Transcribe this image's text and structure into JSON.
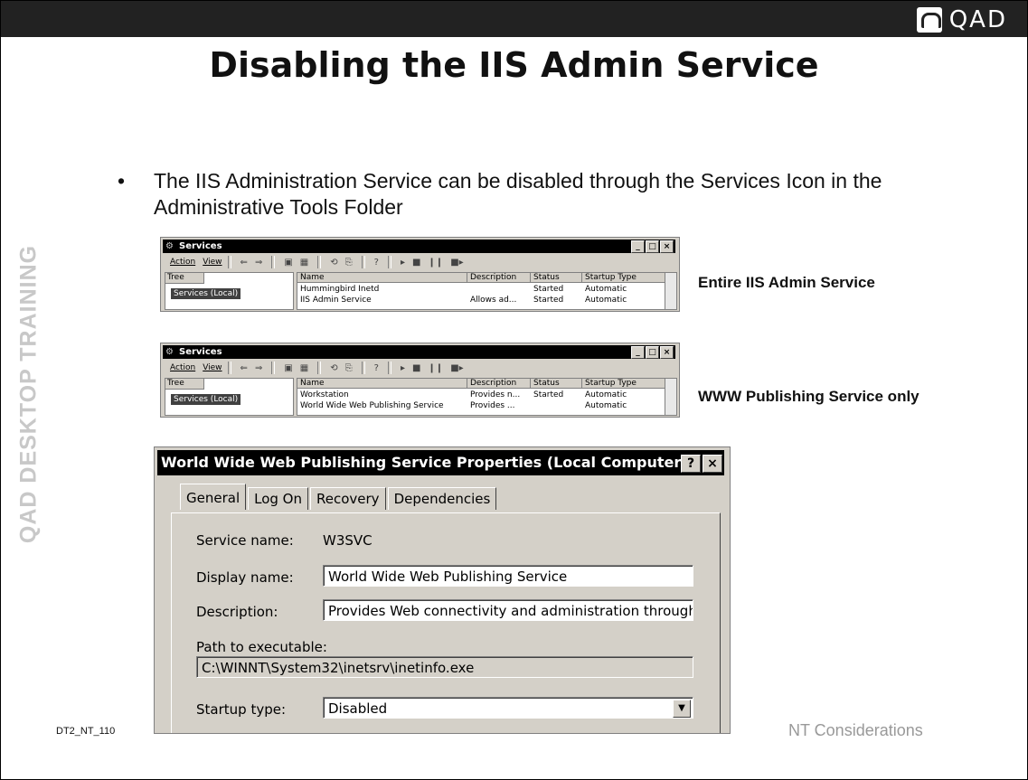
{
  "slide": {
    "logo": "QAD",
    "title": "Disabling the IIS Admin Service",
    "side_text": "QAD DESKTOP TRAINING",
    "bullet_char": "•",
    "bullet_text": "The IIS Administration Service can be disabled through the Services Icon in the Administrative Tools Folder",
    "footer_left": "DT2_NT_110",
    "footer_right": "NT Considerations"
  },
  "services_window_1": {
    "title": "Services",
    "caption": "Entire IIS Admin Service",
    "menu": [
      "Action",
      "View"
    ],
    "tree_header": "Tree",
    "tree_item": "Services (Local)",
    "columns": [
      "Name",
      "Description",
      "Status",
      "Startup Type"
    ],
    "rows": [
      [
        "Hummingbird Inetd",
        "",
        "Started",
        "Automatic"
      ],
      [
        "IIS Admin Service",
        "Allows ad...",
        "Started",
        "Automatic"
      ]
    ]
  },
  "services_window_2": {
    "title": "Services",
    "caption": "WWW Publishing Service only",
    "menu": [
      "Action",
      "View"
    ],
    "tree_header": "Tree",
    "tree_item": "Services (Local)",
    "columns": [
      "Name",
      "Description",
      "Status",
      "Startup Type"
    ],
    "rows": [
      [
        "Workstation",
        "Provides n...",
        "Started",
        "Automatic"
      ],
      [
        "World Wide Web Publishing Service",
        "Provides ...",
        "",
        "Automatic"
      ]
    ]
  },
  "dialog": {
    "title": "World Wide Web Publishing Service Properties (Local Computer)",
    "help_button": "?",
    "close_button": "×",
    "tabs": [
      "General",
      "Log On",
      "Recovery",
      "Dependencies"
    ],
    "service_name_label": "Service name:",
    "service_name_value": "W3SVC",
    "display_name_label": "Display name:",
    "display_name_value": "World Wide Web Publishing Service",
    "description_label": "Description:",
    "description_value": "Provides Web connectivity and administration through t",
    "path_label": "Path to executable:",
    "path_value": "C:\\WINNT\\System32\\inetsrv\\inetinfo.exe",
    "startup_type_label": "Startup type:",
    "startup_type_value": "Disabled"
  }
}
